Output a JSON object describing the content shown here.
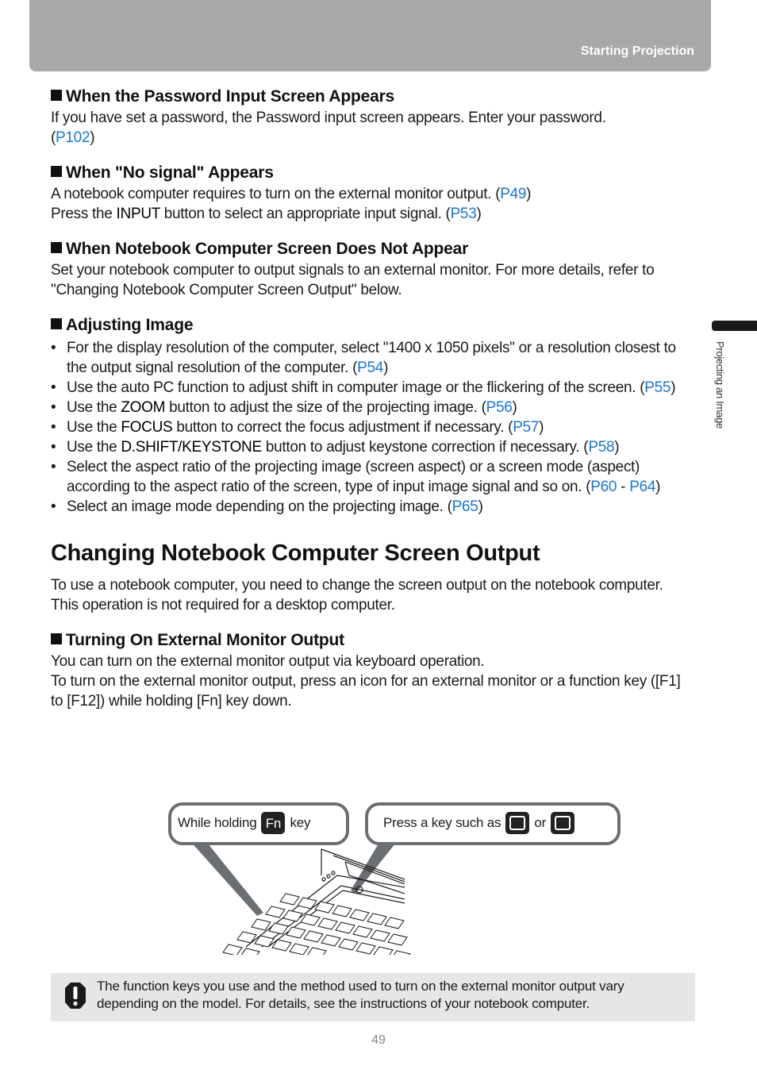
{
  "header": {
    "title": "Starting Projection"
  },
  "side_tab": {
    "label": "Projecting an Image"
  },
  "sections": [
    {
      "heading": "When the Password Input Screen Appears",
      "lines": [
        [
          {
            "t": "If you have set a password, the Password input screen appears. Enter your password. "
          }
        ],
        [
          {
            "t": "("
          },
          {
            "t": "P102",
            "link": true
          },
          {
            "t": ")"
          }
        ]
      ]
    },
    {
      "heading": "When \"No signal\" Appears",
      "lines": [
        [
          {
            "t": "A notebook computer requires to turn on the external monitor output. ("
          },
          {
            "t": "P49",
            "link": true
          },
          {
            "t": ")"
          }
        ],
        [
          {
            "t": "Press the "
          },
          {
            "t": "INPUT",
            "kw": true
          },
          {
            "t": " button to select an appropriate input signal. ("
          },
          {
            "t": "P53",
            "link": true
          },
          {
            "t": ")"
          }
        ]
      ]
    },
    {
      "heading": "When Notebook Computer Screen Does Not Appear",
      "lines": [
        [
          {
            "t": "Set your notebook computer to output signals to an external monitor. For more details, refer to \"Changing Notebook Computer Screen Output\" below."
          }
        ]
      ]
    }
  ],
  "adjusting": {
    "heading": "Adjusting Image",
    "bullets": [
      [
        {
          "t": "For the display resolution of the computer, select \"1400 x 1050 pixels\" or a resolution closest to the output signal resolution of the computer. ("
        },
        {
          "t": "P54",
          "link": true
        },
        {
          "t": ")"
        }
      ],
      [
        {
          "t": "Use the auto PC function to adjust shift in computer image or the flickering of the screen. ("
        },
        {
          "t": "P55",
          "link": true
        },
        {
          "t": ")"
        }
      ],
      [
        {
          "t": "Use the "
        },
        {
          "t": "ZOOM",
          "kw": true
        },
        {
          "t": " button to adjust the size of the projecting image. ("
        },
        {
          "t": "P56",
          "link": true
        },
        {
          "t": ")"
        }
      ],
      [
        {
          "t": "Use the "
        },
        {
          "t": "FOCUS",
          "kw": true
        },
        {
          "t": " button to correct the focus adjustment if necessary. ("
        },
        {
          "t": "P57",
          "link": true
        },
        {
          "t": ")"
        }
      ],
      [
        {
          "t": "Use the "
        },
        {
          "t": "D.SHIFT/KEYSTONE",
          "kw": true
        },
        {
          "t": " button to adjust keystone correction if necessary. ("
        },
        {
          "t": "P58",
          "link": true
        },
        {
          "t": ")"
        }
      ],
      [
        {
          "t": "Select the aspect ratio of the projecting image (screen aspect) or a screen mode (aspect) according to the aspect ratio of the screen, type of input image signal and so on. ("
        },
        {
          "t": "P60",
          "link": true
        },
        {
          "t": " - "
        },
        {
          "t": "P64",
          "link": true
        },
        {
          "t": ")"
        }
      ],
      [
        {
          "t": "Select an image mode depending on the projecting image. ("
        },
        {
          "t": "P65",
          "link": true
        },
        {
          "t": ")"
        }
      ]
    ]
  },
  "main": {
    "title": "Changing Notebook Computer Screen Output",
    "intro": [
      "To use a notebook computer, you need to change the screen output on the notebook computer.",
      "This operation is not required for a desktop computer."
    ],
    "sub": {
      "heading": "Turning On External Monitor Output",
      "lines": [
        "You can turn on the external monitor output via keyboard operation.",
        "To turn on the external monitor output, press an icon for an external monitor or a function key ([F1] to [F12]) while holding [Fn] key down."
      ]
    }
  },
  "illustration": {
    "bubble_left": {
      "before": "While holding",
      "key": "Fn",
      "after": "key"
    },
    "bubble_right": {
      "before": "Press a key such as",
      "middle": "or"
    }
  },
  "note": {
    "icon": "caution-icon",
    "text": "The function keys you use and the method used to turn on the external monitor output vary depending on the model. For details, see the instructions of your notebook computer."
  },
  "page_number": "49",
  "colors": {
    "link": "#1a76d2",
    "header_bg": "#a8a8a8",
    "note_bg": "#e6e6e6"
  }
}
